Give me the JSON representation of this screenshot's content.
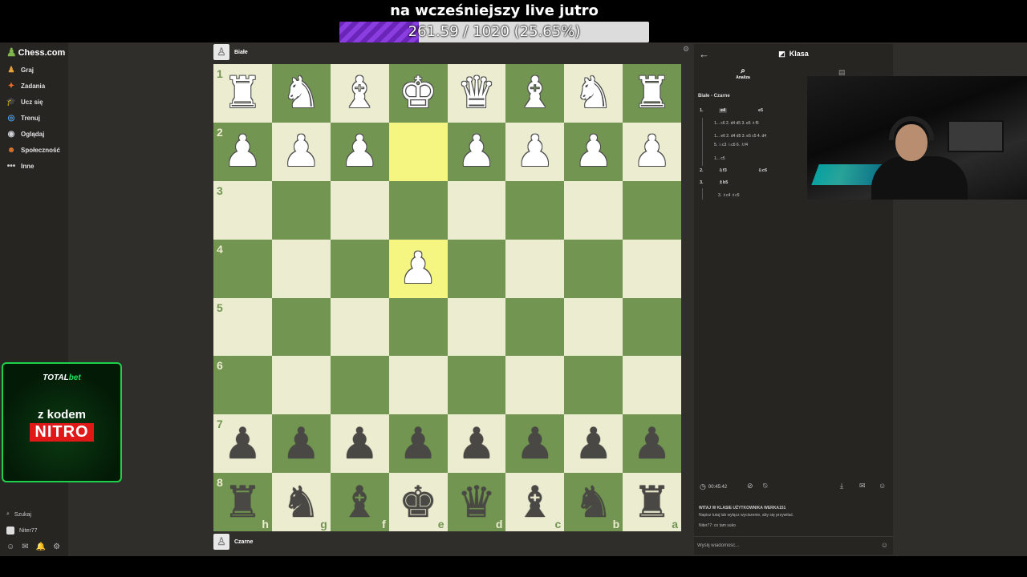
{
  "overlay": {
    "title": "na wcześniejszy live jutro",
    "progress_text": "261.59 / 1020 (25.65%)",
    "progress_fraction": 0.2565,
    "progress_color": "#7a2fd0"
  },
  "sidebar": {
    "logo": "Chess.com",
    "items": [
      {
        "label": "Graj",
        "icon": "play-icon",
        "glyph": "♟"
      },
      {
        "label": "Zadania",
        "icon": "puzzle-icon",
        "glyph": "✦"
      },
      {
        "label": "Ucz się",
        "icon": "learn-icon",
        "glyph": "🎓"
      },
      {
        "label": "Trenuj",
        "icon": "train-icon",
        "glyph": "◎"
      },
      {
        "label": "Oglądaj",
        "icon": "watch-icon",
        "glyph": "◉"
      },
      {
        "label": "Społeczność",
        "icon": "community-icon",
        "glyph": "☻"
      },
      {
        "label": "Inne",
        "icon": "more-icon",
        "glyph": "•••"
      }
    ],
    "search_label": "Szukaj",
    "username": "Niter77",
    "promo": {
      "brand_left": "TOTAL",
      "brand_right": "bet",
      "line1": "z kodem",
      "code": "NITRO"
    }
  },
  "players": {
    "top": "Białe",
    "bottom": "Czarne"
  },
  "board": {
    "files_bottom": [
      "h",
      "g",
      "f",
      "e",
      "d",
      "c",
      "b",
      "a"
    ],
    "ranks_left": [
      "1",
      "2",
      "3",
      "4",
      "5",
      "6",
      "7",
      "8"
    ],
    "light_color": "#ebecd0",
    "dark_color": "#739552",
    "highlight_color": "#f5f682",
    "rows": [
      [
        "wR",
        "wN",
        "wB",
        "wK",
        "wQ",
        "wB",
        "wN",
        "wR"
      ],
      [
        "wP",
        "wP",
        "wP",
        "",
        "wP",
        "wP",
        "wP",
        "wP"
      ],
      [
        "",
        "",
        "",
        "",
        "",
        "",
        "",
        ""
      ],
      [
        "",
        "",
        "",
        "wP",
        "",
        "",
        "",
        ""
      ],
      [
        "",
        "",
        "",
        "",
        "",
        "",
        "",
        ""
      ],
      [
        "",
        "",
        "",
        "",
        "",
        "",
        "",
        ""
      ],
      [
        "bP",
        "bP",
        "bP",
        "bP",
        "bP",
        "bP",
        "bP",
        "bP"
      ],
      [
        "bR",
        "bN",
        "bB",
        "bK",
        "bQ",
        "bB",
        "bN",
        "bR"
      ]
    ],
    "highlighted": [
      [
        1,
        3
      ],
      [
        3,
        3
      ]
    ]
  },
  "panel": {
    "title": "Klasa",
    "tab_analysis": "Analiza",
    "pgn_header": "Białe - Czarne",
    "moves": [
      {
        "num": "1.",
        "white": "e4",
        "black": "e5"
      },
      {
        "num": "2.",
        "white": "♘f3",
        "black": "♘c6"
      },
      {
        "num": "3.",
        "white": "♗b5",
        "black": ""
      }
    ],
    "variations": [
      "1... c6  2. d4  d5  3. e5  ♗f5",
      "1... e6  2. d4  d5  3. e5  c5  4. d4",
      "5. ♘c3  ♘c6  6. ♗f4",
      "1... c5",
      "3. ♗c4  ♗c5"
    ],
    "timer": "00:45:42",
    "chat_welcome": "WITAJ W KLASIE UŻYTKOWNIKA WERKA151",
    "chat_hint": "Napisz tutaj lub wyłącz wyciszenie, aby się przywitać.",
    "chat_message": "Niter77: co tam suko",
    "chat_placeholder": "Wyślij wiadomość..."
  }
}
